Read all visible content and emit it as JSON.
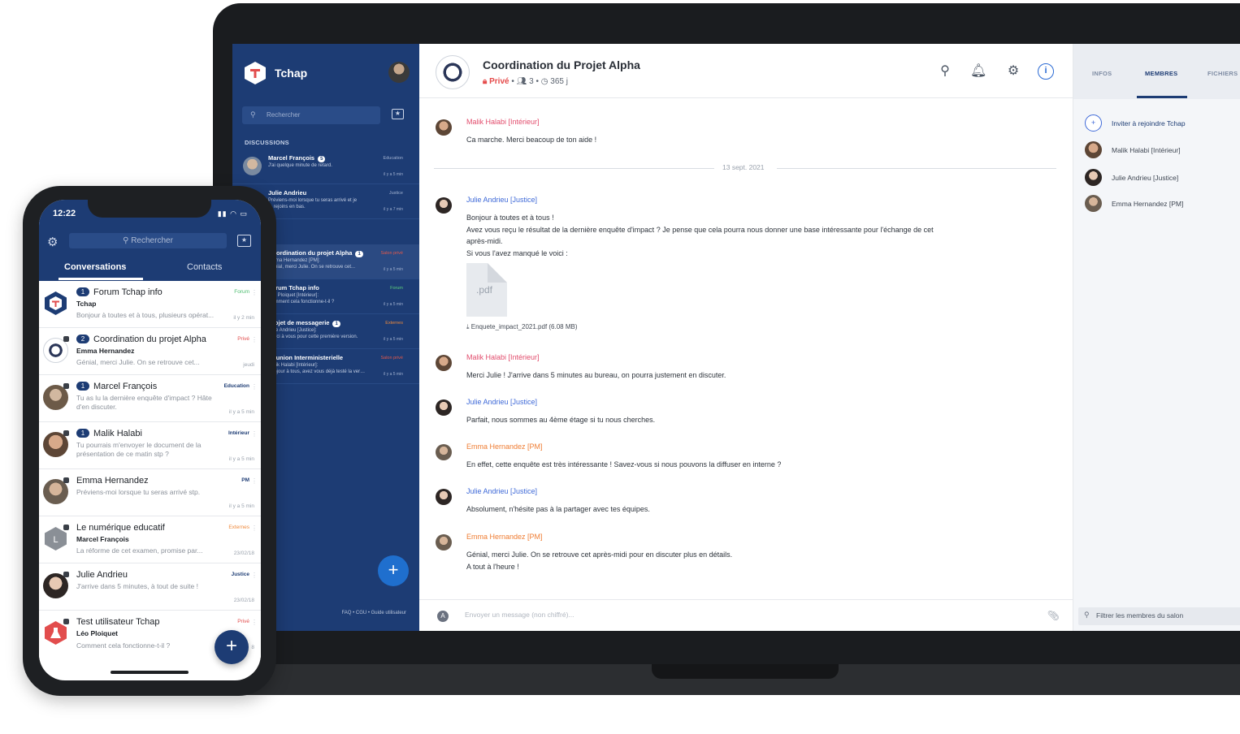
{
  "colors": {
    "navy": "#1d3c74",
    "accent_blue": "#3f6ad8",
    "red": "#e24d6d",
    "orange": "#ef7d33"
  },
  "desktop": {
    "sidebar": {
      "app_name": "Tchap",
      "search_placeholder": "Rechercher",
      "section_label": "DISCUSSIONS",
      "rooms": [
        {
          "name": "Marcel François",
          "badge": "5",
          "preview1": "J'ai quelque minute de retard.",
          "preview2": "",
          "tag": "Education",
          "time": "il y a 5 min"
        },
        {
          "name": "Julie Andrieu",
          "badge": "",
          "preview1": "Préviens-moi lorsque tu seras arrivé et je",
          "preview2": "te rejoins en bas.",
          "tag": "Justice",
          "time": "il y a 7 min"
        },
        {
          "name": "Coordination du projet Alpha",
          "badge": "1",
          "preview1": "Emma Hernandez [PM]:",
          "preview2": "Génial, merci Julie. On se retrouve cet...",
          "tag": "Salon privé",
          "time": "il y a 5 min"
        },
        {
          "name": "Forum Tchap info",
          "badge": "",
          "preview1": "Léo Ploiquet [Intérieur]:",
          "preview2": "Comment cela fonctionne-t-il ?",
          "tag": "Forum",
          "time": "il y a 5 min"
        },
        {
          "name": "Projet de messagerie",
          "badge": "1",
          "preview1": "Julie Andrieu [Justice]:",
          "preview2": "Merci à vous pour cette première version.",
          "tag": "Externes",
          "time": "il y a 5 min"
        },
        {
          "name": "Réunion Interministerielle",
          "badge": "",
          "preview1": "Malik Halabi [Intérieur]:",
          "preview2": "Bonjour à tous, avez vous déjà testé la versio...",
          "tag": "Salon privé",
          "time": "il y a 5 min"
        }
      ],
      "footer": "FAQ • CGU • Guide utilisateur",
      "fab_label": "+"
    },
    "header": {
      "title": "Coordination du Projet Alpha",
      "privacy": "Privé",
      "members": "3",
      "retention": "365 j"
    },
    "messages": [
      {
        "author": "Malik Halabi [Intérieur]",
        "lines": [
          "Ca marche. Merci beacoup de ton aide !"
        ]
      },
      {
        "author": "Julie Andrieu [Justice]",
        "lines": [
          "Bonjour à toutes et à tous !",
          "Avez vous reçu le résultat de la dernière enquête d'impact ? Je pense que cela pourra nous donner une base intéressante pour l'échange de cet",
          "après-midi.",
          "Si vous l'avez manqué le voici :"
        ]
      },
      {
        "author": "Malik Halabi [Intérieur]",
        "lines": [
          "Merci Julie ! J'arrive dans 5 minutes au bureau, on pourra justement en discuter."
        ]
      },
      {
        "author": "Julie Andrieu [Justice]",
        "lines": [
          "Parfait, nous sommes au 4ème étage si tu nous cherches."
        ]
      },
      {
        "author": "Emma Hernandez [PM]",
        "lines": [
          "En effet, cette enquête est très intéressante ! Savez-vous si nous pouvons la diffuser en interne ?"
        ]
      },
      {
        "author": "Julie Andrieu [Justice]",
        "lines": [
          "Absolument, n'hésite pas à la partager avec tes équipes."
        ]
      },
      {
        "author": "Emma Hernandez [PM]",
        "lines": [
          "Génial, merci Julie. On se retrouve cet après-midi pour en discuter plus en détails.",
          "A tout à l'heure !"
        ]
      }
    ],
    "date_separator": "13 sept. 2021",
    "attachment": {
      "ext": ".pdf",
      "filename": "⤓ Enquete_impact_2021.pdf (6.08 MB)"
    },
    "composer": {
      "avatar_letter": "A",
      "placeholder": "Envoyer un message (non chiffré)..."
    },
    "right_panel": {
      "tabs": [
        "INFOS",
        "MEMBRES",
        "FICHIERS"
      ],
      "invite": "Inviter à rejoindre Tchap",
      "members": [
        "Malik Halabi [Intérieur]",
        "Julie Andrieu [Justice]",
        "Emma Hernandez [PM]"
      ],
      "filter_placeholder": "Filtrer les membres du salon"
    }
  },
  "mobile": {
    "time": "12:22",
    "search_placeholder": "Rechercher",
    "tabs": [
      "Conversations",
      "Contacts"
    ],
    "items": [
      {
        "badge": "1",
        "name": "Forum Tchap info",
        "sub": "Tchap",
        "preview": "Bonjour à toutes et à tous, plusieurs opérat...",
        "tag": "Forum",
        "time": "il y 2 min"
      },
      {
        "badge": "2",
        "name": "Coordination du projet Alpha",
        "sub": "Emma Hernandez",
        "preview": "Génial, merci Julie. On se retrouve cet...",
        "tag": "Privé",
        "time": "jeudi"
      },
      {
        "badge": "1",
        "name": "Marcel François",
        "sub": "",
        "preview": "Tu as lu la dernière enquête d'impact ? Hâte d'en discuter.",
        "tag": "Education",
        "time": "il y a 5 min"
      },
      {
        "badge": "1",
        "name": "Malik Halabi",
        "sub": "",
        "preview": "Tu pourrais m'envoyer le document de la présentation de ce matin stp ?",
        "tag": "Intérieur",
        "time": "il y a 5 min"
      },
      {
        "badge": "",
        "name": "Emma Hernandez",
        "sub": "",
        "preview": "Préviens-moi lorsque tu seras arrivé stp.",
        "tag": "PM",
        "time": "il y a 5 min"
      },
      {
        "badge": "",
        "name": "Le numérique educatif",
        "sub": "Marcel François",
        "preview": "La réforme de cet examen, promise par...",
        "tag": "Externes",
        "time": "23/02/18"
      },
      {
        "badge": "",
        "name": "Julie Andrieu",
        "sub": "",
        "preview": "J'arrive dans 5 minutes, à tout de suite !",
        "tag": "Justice",
        "time": "23/02/18"
      },
      {
        "badge": "",
        "name": "Test utilisateur Tchap",
        "sub": "Léo Ploiquet",
        "preview": "Comment cela fonctionne-t-il ?",
        "tag": "Privé",
        "time": "8"
      }
    ],
    "fab_label": "+"
  }
}
